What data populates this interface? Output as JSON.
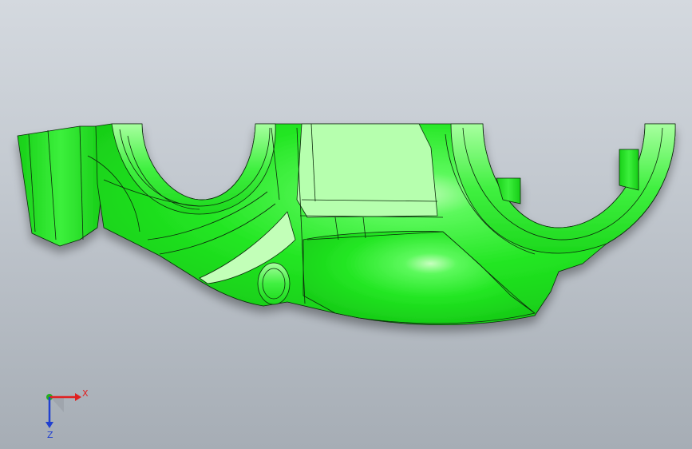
{
  "viewport": {
    "background_top": "#d4d9df",
    "background_bottom": "#a6adb5"
  },
  "model": {
    "name": "",
    "shade_color": "#1ee61e",
    "edge_color": "#0a2a0a"
  },
  "triad": {
    "x_label": "X",
    "z_label": "Z",
    "x_color": "#e02020",
    "y_color": "#20b020",
    "z_color": "#2040d0"
  }
}
